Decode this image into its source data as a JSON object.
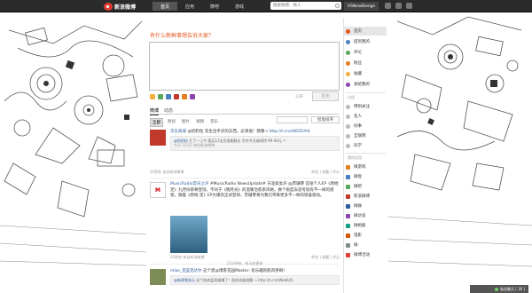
{
  "topbar": {
    "brand": "新浪微博",
    "nav": [
      "首页",
      "应用",
      "微吧",
      "游戏"
    ],
    "search_placeholder": "搜索微博、找人",
    "username": "VSNewDesign"
  },
  "composer": {
    "prompt": "有什么新鲜事想告诉大家？",
    "public_label": "公开",
    "publish_label": "发布"
  },
  "feed": {
    "tabs": [
      "微博",
      "动态"
    ],
    "filters": [
      "全部",
      "原创",
      "图片",
      "视频",
      "音乐"
    ],
    "sort_label": "智能排序",
    "posts": [
      {
        "user": "京东商城",
        "text": "@奶奶粒 先生出手买的东西，必须值！猜猜→",
        "link": "http://t.cn/zWD5UA4",
        "repost_user": "@奶奶粒",
        "repost_text": "忙了一上午 我买12支芳香跑鞋水 京东今天继续特 99-40元 ↑",
        "repost_time": "今天 12:22",
        "repost_via": "来自新浪微博",
        "time": "20秒前",
        "via": "来自新浪微博",
        "counts": "转发 | 收藏 | 评论"
      },
      {
        "user": "MusicRadio音乐之声",
        "text": "#MusicRadio NewsUpdate# 天涯如女声 @苏珊芽 首张个人EP《原始 足》九月份即将登场。不同于《晚月光》的温暖治愈系风格，换个角度去思考就有不一样的感受。随着《原始 足》EP大碟的正式登场，苏珊芽将为我们带来更多不一样的惊喜感动。",
        "time": "20秒前",
        "via": "来自新浪微博",
        "counts": "转发 | 收藏 | 评论"
      },
      {
        "user": "mike_克里克达尔",
        "text": "这个黑@博客花园Master: 有乐趣的肌肉男啊！",
        "repost_user": "@新视频系乐",
        "repost_text": "这个肌肉猛男美爆了！肌肉也能跳舞 → http://t.cn/zWeb6z5",
        "new_count": "23分钟前，新动态更新"
      }
    ]
  },
  "sidebar": {
    "items": [
      "首页",
      "提到我的",
      "评论",
      "粉丝",
      "收藏",
      "发给我的"
    ],
    "group_head": "分组",
    "groups": [
      "特别关注",
      "名人",
      "同事",
      "互联网",
      "同学"
    ],
    "apps_head": "我的应用",
    "apps": [
      "微游戏",
      "微盘",
      "微吧",
      "新浪微博",
      "微群",
      "微访谈",
      "微相册",
      "电影",
      "微",
      "微博活动"
    ]
  },
  "chat": {
    "label": "私信聊天 [ 30 ]"
  },
  "colors": {
    "accent": "#e6551c",
    "link": "#2a5c9a",
    "topbar": "#2b2b2b"
  }
}
